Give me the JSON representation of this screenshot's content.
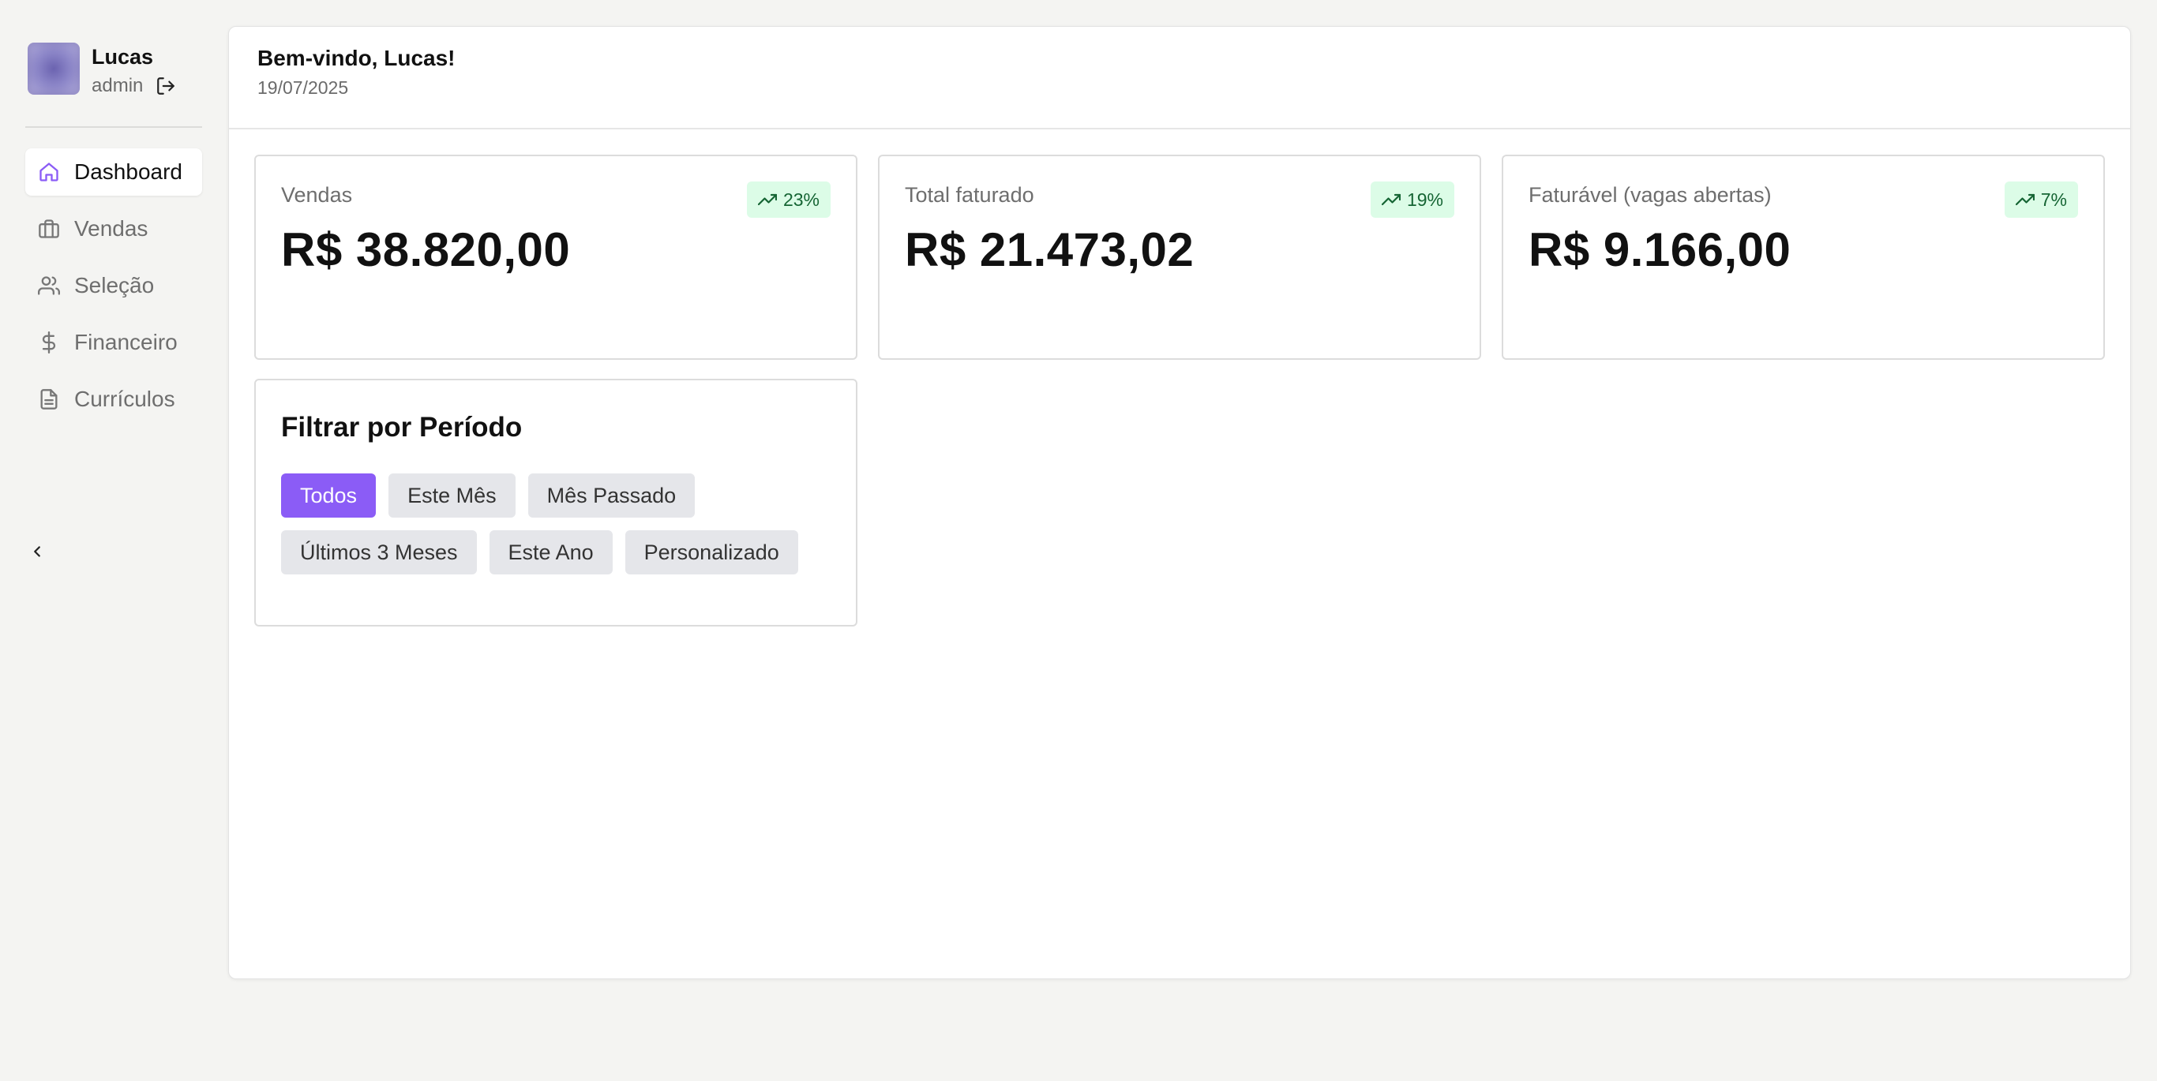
{
  "user": {
    "name": "Lucas",
    "role": "admin"
  },
  "sidebar": {
    "items": [
      {
        "label": "Dashboard",
        "icon": "home-icon",
        "active": true
      },
      {
        "label": "Vendas",
        "icon": "briefcase-icon",
        "active": false
      },
      {
        "label": "Seleção",
        "icon": "users-icon",
        "active": false
      },
      {
        "label": "Financeiro",
        "icon": "dollar-icon",
        "active": false
      },
      {
        "label": "Currículos",
        "icon": "document-icon",
        "active": false
      }
    ]
  },
  "header": {
    "welcome": "Bem-vindo, Lucas!",
    "date": "19/07/2025"
  },
  "stats": [
    {
      "title": "Vendas",
      "value": "R$ 38.820,00",
      "change": "23%"
    },
    {
      "title": "Total faturado",
      "value": "R$ 21.473,02",
      "change": "19%"
    },
    {
      "title": "Faturável (vagas abertas)",
      "value": "R$ 9.166,00",
      "change": "7%"
    }
  ],
  "filter": {
    "title": "Filtrar por Período",
    "options": [
      "Todos",
      "Este Mês",
      "Mês Passado",
      "Últimos 3 Meses",
      "Este Ano",
      "Personalizado"
    ],
    "selected": "Todos"
  },
  "colors": {
    "accent": "#8b5cf6",
    "badge_bg": "#dcfce7",
    "badge_text": "#166534",
    "background": "#f4f4f2"
  }
}
